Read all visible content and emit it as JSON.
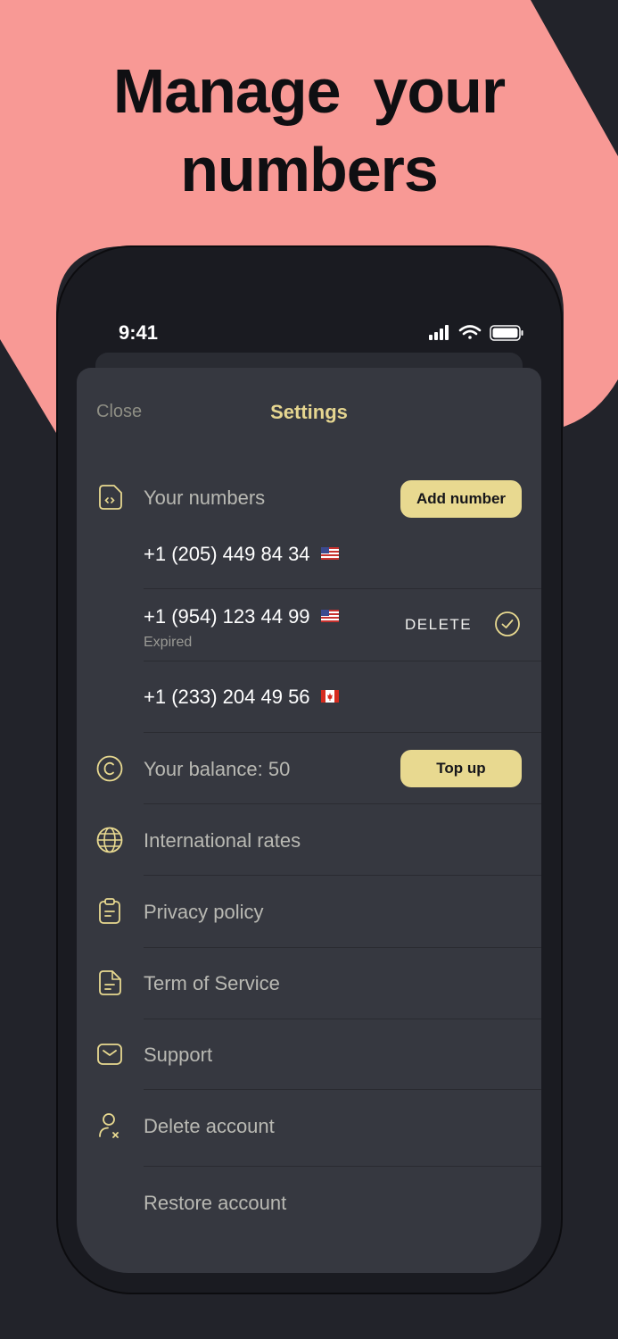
{
  "promo": {
    "headline_line1": "Manage  your",
    "headline_line2": "numbers"
  },
  "status_bar": {
    "time": "9:41",
    "icons": [
      "signal-icon",
      "wifi-icon",
      "battery-icon"
    ]
  },
  "header": {
    "close_label": "Close",
    "title": "Settings"
  },
  "numbers_section": {
    "label": "Your numbers",
    "icon": "sim-card-icon",
    "add_button": "Add number",
    "numbers": [
      {
        "value": "+1 (205) 449 84 34",
        "flag": "us-flag"
      },
      {
        "value": "+1 (954) 123 44 99",
        "flag": "us-flag",
        "status": "Expired",
        "action": "DELETE",
        "selected": true
      },
      {
        "value": "+1 (233) 204 49 56",
        "flag": "ca-flag"
      }
    ]
  },
  "balance": {
    "label": "Your balance: 50",
    "icon": "coin-icon",
    "button": "Top up"
  },
  "menu": [
    {
      "label": "International rates",
      "icon": "globe-icon"
    },
    {
      "label": "Privacy policy",
      "icon": "clipboard-icon"
    },
    {
      "label": "Term of Service",
      "icon": "document-icon"
    },
    {
      "label": "Support",
      "icon": "mail-icon"
    },
    {
      "label": "Delete account",
      "icon": "user-remove-icon"
    },
    {
      "label": "Restore account"
    }
  ],
  "colors": {
    "background": "#22232a",
    "blob": "#f89995",
    "accent": "#e8d990",
    "sheet": "#363840",
    "phone": "#1a1b21"
  }
}
